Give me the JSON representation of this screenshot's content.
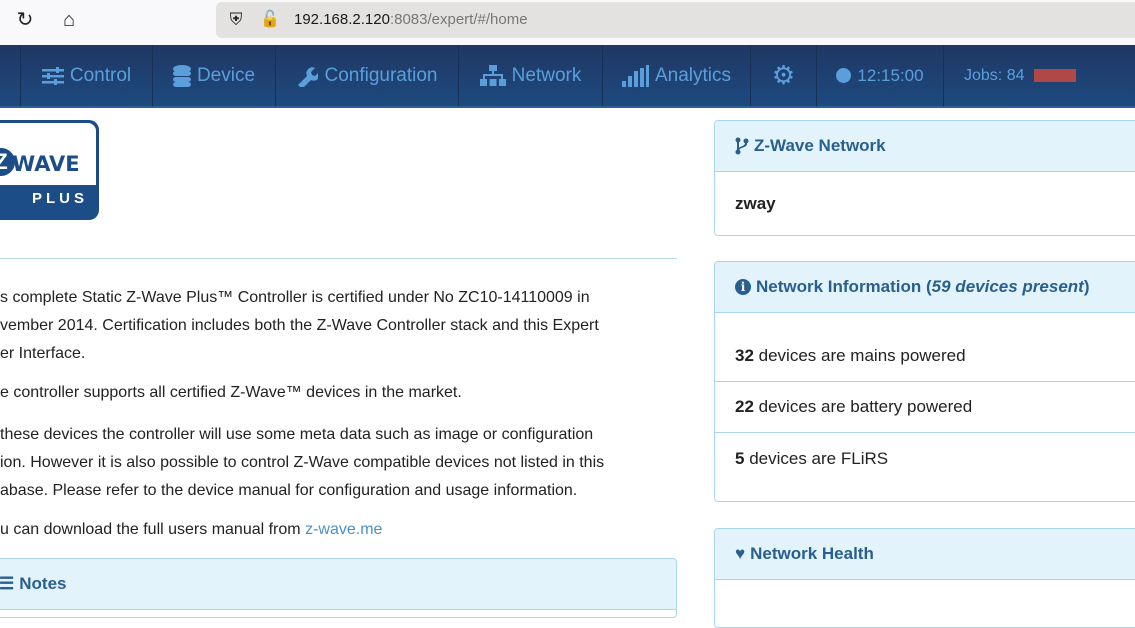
{
  "browser": {
    "url_host": "192.168.2.120",
    "url_rest": ":8083/expert/#/home"
  },
  "nav": {
    "items": [
      {
        "label": "Control"
      },
      {
        "label": "Device"
      },
      {
        "label": "Configuration"
      },
      {
        "label": "Network"
      },
      {
        "label": "Analytics"
      }
    ],
    "time": "12:15:00",
    "jobs": "Jobs: 84"
  },
  "logo": {
    "text": "Z-WAVE PLUS"
  },
  "intro": {
    "lines": [
      "s complete Static Z-Wave Plus™ Controller is certified under No ZC10-14110009 in",
      "vember 2014. Certification includes both the Z-Wave Controller stack and this Expert",
      "er Interface.",
      "e controller supports all certified Z-Wave™ devices in the market.",
      " these devices the controller will use some meta data such as image or configuration",
      "ion. However it is also possible to control Z-Wave compatible devices not listed in this",
      "abase. Please refer to the device manual for configuration and usage information."
    ],
    "manual_text": "u can download the full users manual from ",
    "manual_link": "z-wave.me"
  },
  "notes": {
    "title": "Notes"
  },
  "zwave_network": {
    "title": "Z-Wave Network",
    "name": "zway"
  },
  "network_info": {
    "title": "Network Information (",
    "count_text": "59 devices present",
    "close": ")",
    "rows": [
      {
        "count": "32",
        "text": " devices are mains powered"
      },
      {
        "count": "22",
        "text": " devices are battery powered"
      },
      {
        "count": "5",
        "text": " devices are FLiRS"
      }
    ]
  },
  "network_health": {
    "title": "Network Health"
  }
}
